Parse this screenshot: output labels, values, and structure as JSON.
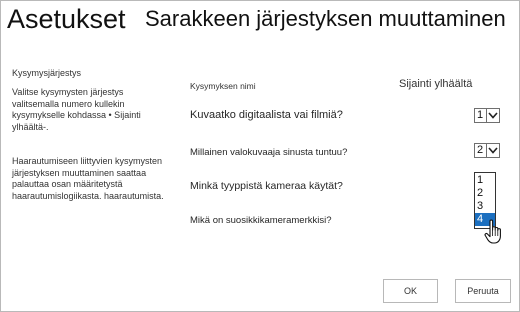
{
  "header": {
    "title": "Asetukset",
    "subtitle": "Sarakkeen järjestyksen muuttaminen"
  },
  "sidebar": {
    "heading": "Kysymysjärjestys",
    "description_1": "Valitse kysymysten järjestys valitsemalla numero kullekin kysymykselle kohdassa • Sijainti ylhäältä-.",
    "description_2": "Haarautumiseen liittyvien kysymysten järjestyksen muuttaminen saattaa palauttaa osan määritetystä haarautumislogiikasta. haarautumista."
  },
  "table": {
    "question_header": "Kysymyksen nimi",
    "position_header": "Sijainti ylhäältä",
    "rows": [
      {
        "question": "Kuvaatko digitaalista vai filmiä?",
        "position": "1"
      },
      {
        "question": "Millainen valokuvaaja sinusta tuntuu?",
        "position": "2"
      },
      {
        "question": "Minkä tyyppistä kameraa käytät?",
        "position": ""
      },
      {
        "question": "Mikä on suosikkikameramerkkisi?",
        "position": ""
      }
    ]
  },
  "dropdown": {
    "options": [
      "1",
      "2",
      "3",
      "4"
    ],
    "highlighted": "4"
  },
  "colors": {
    "highlight": "#1b6fc0"
  },
  "icons": {
    "select_arrow": "chevron-down-icon",
    "cursor": "hand-pointer-icon"
  },
  "buttons": {
    "ok": "OK",
    "cancel": "Peruuta"
  }
}
